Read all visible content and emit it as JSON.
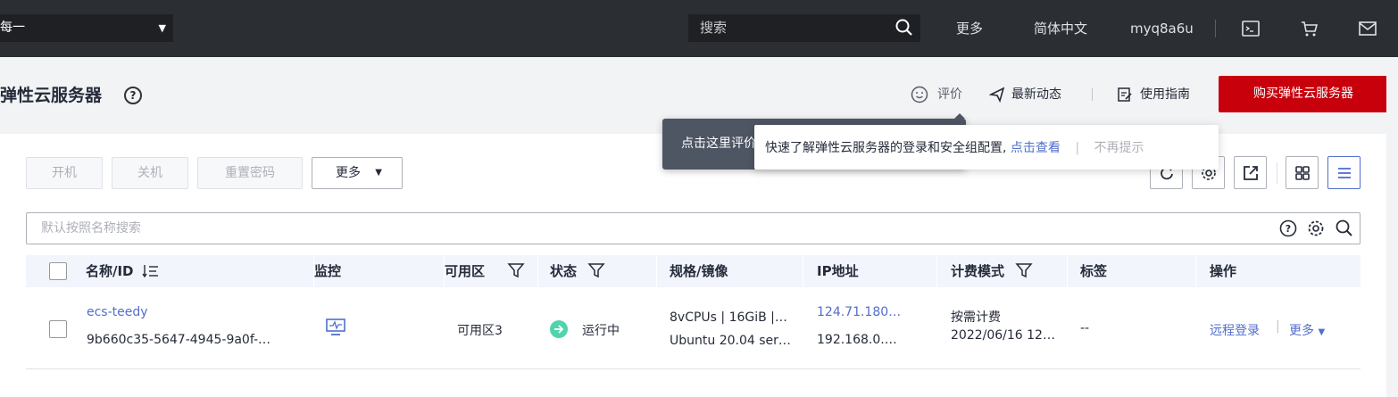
{
  "topbar": {
    "region": "每一",
    "search_placeholder": "搜索",
    "links": [
      "更多",
      "简体中文",
      "myq8a6u"
    ]
  },
  "header": {
    "title": "弹性云服务器",
    "feedback": "评价",
    "news": "最新动态",
    "guide": "使用指南",
    "buy": "购买弹性云服务器"
  },
  "toolbar": {
    "start": "开机",
    "stop": "关机",
    "reset_pwd": "重置密码",
    "more": "更多"
  },
  "filter": {
    "placeholder": "默认按照名称搜索"
  },
  "table": {
    "headers": [
      "名称/ID",
      "监控",
      "可用区",
      "状态",
      "规格/镜像",
      "IP地址",
      "计费模式",
      "标签",
      "操作"
    ],
    "rows": [
      {
        "name": "ecs-teedy",
        "id": "9b660c35-5647-4945-9a0f-…",
        "zone": "可用区3",
        "status": "运行中",
        "spec": "8vCPUs | 16GiB |…",
        "image": "Ubuntu 20.04 ser…",
        "ip_public": "124.71.180…",
        "ip_private": "192.168.0.…",
        "billing": "按需计费",
        "billing_date": "2022/06/16 12…",
        "tags": "--",
        "op_login": "远程登录",
        "op_more": "更多"
      }
    ]
  },
  "tooltips": {
    "dark": "点击这里评价",
    "white_text": "快速了解弹性云服务器的登录和安全组配置,",
    "white_link": "点击查看",
    "white_dismiss": "不再提示"
  },
  "colors": {
    "topbar": "#2b2e33",
    "brand_red": "#c7000b",
    "link_blue": "#526ecc",
    "status_green": "#50d4ab"
  }
}
